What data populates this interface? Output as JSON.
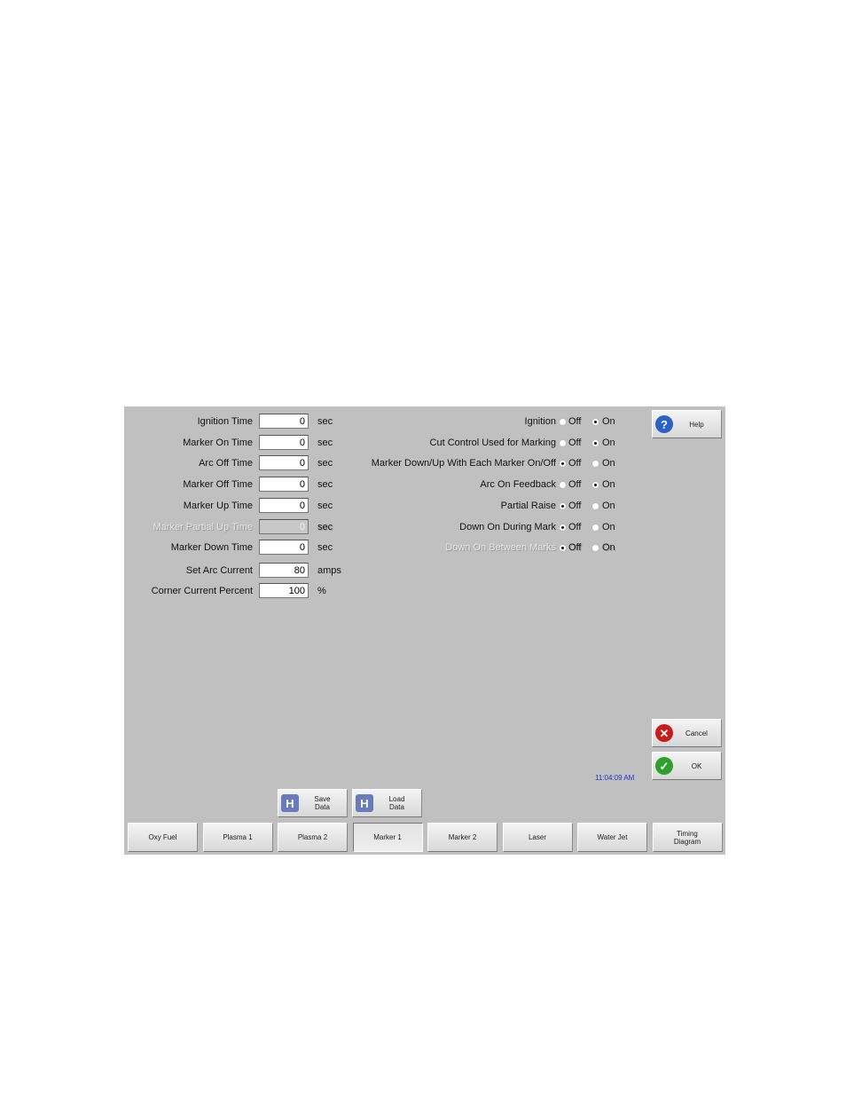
{
  "fields": [
    {
      "label": "Ignition Time",
      "value": "0",
      "unit": "sec",
      "disabled": false
    },
    {
      "label": "Marker On Time",
      "value": "0",
      "unit": "sec",
      "disabled": false
    },
    {
      "label": "Arc Off Time",
      "value": "0",
      "unit": "sec",
      "disabled": false
    },
    {
      "label": "Marker Off Time",
      "value": "0",
      "unit": "sec",
      "disabled": false
    },
    {
      "label": "Marker Up Time",
      "value": "0",
      "unit": "sec",
      "disabled": false
    },
    {
      "label": "Marker Partial Up Time",
      "value": "0",
      "unit": "sec",
      "disabled": true
    },
    {
      "label": "Marker Down Time",
      "value": "0",
      "unit": "sec",
      "disabled": false
    },
    {
      "label": "Set Arc Current",
      "value": "80",
      "unit": "amps",
      "disabled": false
    },
    {
      "label": "Corner Current Percent",
      "value": "100",
      "unit": "%",
      "disabled": false
    }
  ],
  "options": [
    {
      "label": "Ignition",
      "selected": "On",
      "disabled": false
    },
    {
      "label": "Cut Control Used for Marking",
      "selected": "On",
      "disabled": false
    },
    {
      "label": "Marker Down/Up With Each Marker On/Off",
      "selected": "Off",
      "disabled": false
    },
    {
      "label": "Arc On Feedback",
      "selected": "On",
      "disabled": false
    },
    {
      "label": "Partial Raise",
      "selected": "Off",
      "disabled": false
    },
    {
      "label": "Down On During Mark",
      "selected": "Off",
      "disabled": false
    },
    {
      "label": "Down On Between Marks",
      "selected": "Off",
      "disabled": true
    }
  ],
  "radio_labels": {
    "off": "Off",
    "on": "On"
  },
  "buttons": {
    "help": "Help",
    "cancel": "Cancel",
    "ok": "OK",
    "save": "Save Data",
    "load": "Load Data"
  },
  "time": "11:04:09 AM",
  "tabs": [
    {
      "label": "Oxy Fuel"
    },
    {
      "label": "Plasma 1"
    },
    {
      "label": "Plasma 2"
    },
    {
      "label": "Marker 1",
      "active": true
    },
    {
      "label": "Marker 2"
    },
    {
      "label": "Laser"
    },
    {
      "label": "Water Jet"
    },
    {
      "label": "Timing Diagram"
    }
  ],
  "colors": {
    "panel": "#c0c0c0",
    "time": "#2233cc"
  }
}
